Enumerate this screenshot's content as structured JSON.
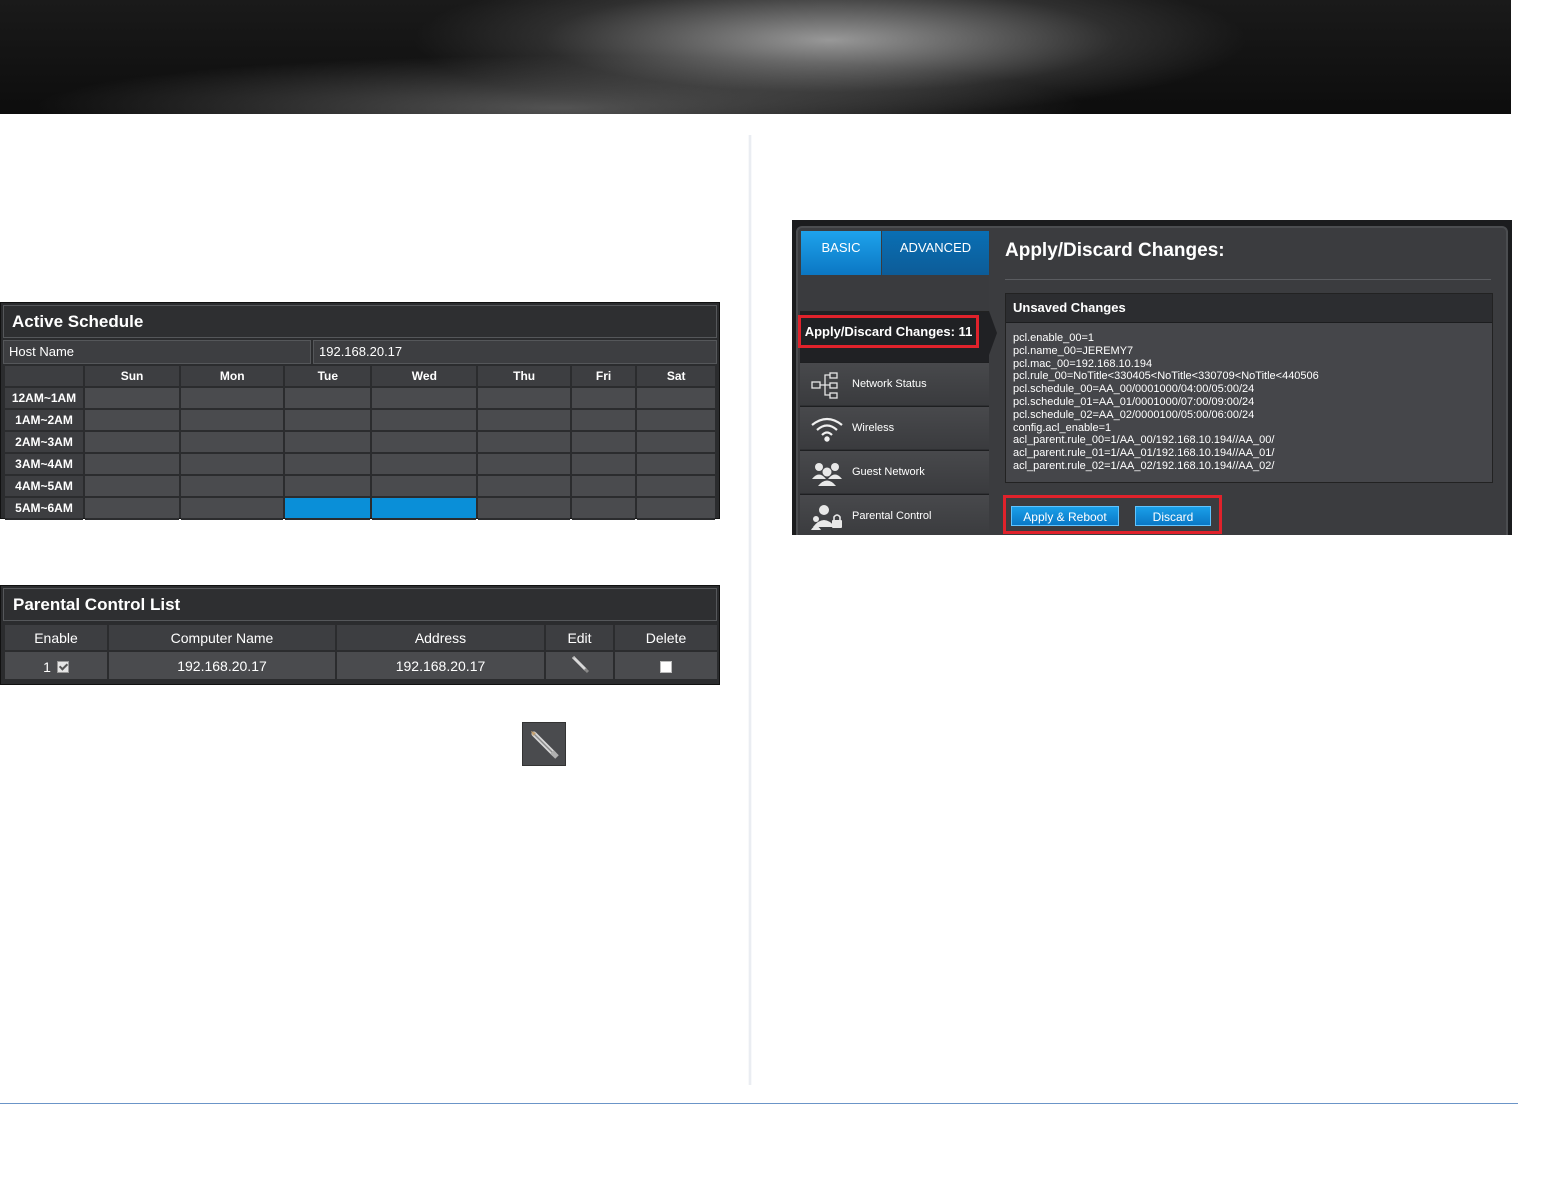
{
  "schedule": {
    "title": "Active Schedule",
    "host_label": "Host Name",
    "host_value": "192.168.20.17",
    "days": [
      "Sun",
      "Mon",
      "Tue",
      "Wed",
      "Thu",
      "Fri",
      "Sat"
    ],
    "times": [
      "12AM~1AM",
      "1AM~2AM",
      "2AM~3AM",
      "3AM~4AM",
      "4AM~5AM",
      "5AM~6AM"
    ],
    "active_cells": [
      {
        "time": "5AM~6AM",
        "day": "Tue"
      },
      {
        "time": "5AM~6AM",
        "day": "Wed"
      }
    ],
    "active_color": "#0a8fd8"
  },
  "parental_list": {
    "title": "Parental Control List",
    "columns": [
      "Enable",
      "Computer Name",
      "Address",
      "Edit",
      "Delete"
    ],
    "rows": [
      {
        "index": "1",
        "enabled": true,
        "computer_name": "192.168.20.17",
        "address": "192.168.20.17",
        "delete_checked": false
      }
    ]
  },
  "edit_button_icon": "pencil-icon",
  "router": {
    "tabs": {
      "basic": "BASIC",
      "advanced": "ADVANCED"
    },
    "apply_item": "Apply/Discard Changes: 11",
    "menu": [
      {
        "label": "Network Status",
        "icon": "network-status-icon"
      },
      {
        "label": "Wireless",
        "icon": "wireless-icon"
      },
      {
        "label": "Guest Network",
        "icon": "guest-network-icon"
      },
      {
        "label": "Parental Control",
        "icon": "parental-control-icon"
      }
    ],
    "page_title": "Apply/Discard Changes:",
    "unsaved_header": "Unsaved Changes",
    "unsaved_lines": [
      "pcl.enable_00=1",
      "pcl.name_00=JEREMY7",
      "pcl.mac_00=192.168.10.194",
      "pcl.rule_00=NoTitle<330405<NoTitle<330709<NoTitle<440506",
      "pcl.schedule_00=AA_00/0001000/04:00/05:00/24",
      "pcl.schedule_01=AA_01/0001000/07:00/09:00/24",
      "pcl.schedule_02=AA_02/0000100/05:00/06:00/24",
      "config.acl_enable=1",
      "acl_parent.rule_00=1/AA_00/192.168.10.194//AA_00/",
      "acl_parent.rule_01=1/AA_01/192.168.10.194//AA_01/",
      "acl_parent.rule_02=1/AA_02/192.168.10.194//AA_02/"
    ],
    "apply_reboot_label": "Apply & Reboot",
    "discard_label": "Discard",
    "highlight_color": "#e0222b"
  }
}
